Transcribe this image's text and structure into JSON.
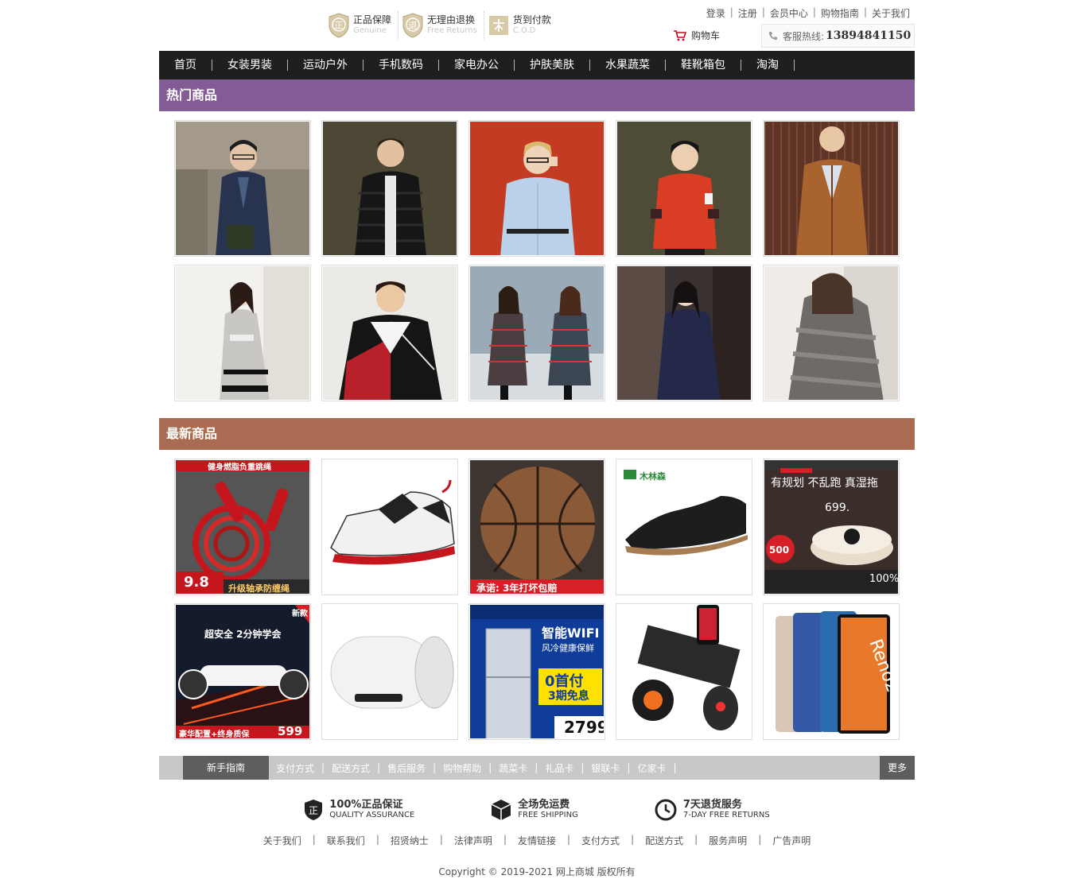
{
  "header": {
    "promises": [
      {
        "icon": "genuine-shield-icon",
        "glyph": "正",
        "cn": "正品保障",
        "en": "Genuine"
      },
      {
        "icon": "free-returns-shield-icon",
        "glyph": "退",
        "cn": "无理由退换",
        "en": "Free Returns"
      },
      {
        "icon": "cod-icon",
        "glyph": "",
        "cn": "货到付款",
        "en": "C.O.D"
      }
    ],
    "toplinks": [
      "登录",
      "注册",
      "会员中心",
      "购物指南",
      "关于我们"
    ],
    "cart_label": "购物车",
    "hotline_label": "客服热线:",
    "hotline_number": "13894841150"
  },
  "nav": [
    "首页",
    "女装男装",
    "运动户外",
    "手机数码",
    "家电办公",
    "护肤美肤",
    "水果蔬菜",
    "鞋靴箱包",
    "淘淘"
  ],
  "hot": {
    "title": "热门商品"
  },
  "latest": {
    "title": "最新商品",
    "labels": {
      "rope_top": "健身燃脂负重跳绳",
      "rope_price": "9.8",
      "rope_tag": "升级轴承防缠绳",
      "ball_tag": "承诺: 3年打坏包赔",
      "shoe_brand": "木林森",
      "robot_title": "有规划 不乱跑 真湿拖",
      "robot_price": "699.",
      "robot_badge": "500",
      "robot_pct": "100%",
      "scooter_top": "超安全 2分钟学会",
      "scooter_badge": "新款",
      "scooter_price": "599",
      "scooter_note": "豪华配置+终身质保",
      "fridge_tag": "智能WIFI",
      "fridge_sub": "风冷健康保鲜",
      "fridge_big": "0首付",
      "fridge_small": "3期免息",
      "fridge_price": "2799",
      "phone_text": "Reno2"
    }
  },
  "footer": {
    "help_first": "新手指南",
    "help_links": [
      "支付方式",
      "配送方式",
      "售后服务",
      "购物帮助",
      "蔬菜卡",
      "礼品卡",
      "银联卡",
      "亿家卡"
    ],
    "more": "更多",
    "guarantees": [
      {
        "icon": "genuine-badge-icon",
        "cn": "100%正品保证",
        "en": "QUALITY ASSURANCE"
      },
      {
        "icon": "shipping-box-icon",
        "cn": "全场免运费",
        "en": "FREE SHIPPING"
      },
      {
        "icon": "clock-icon",
        "cn": "7天退货服务",
        "en": "7-DAY FREE RETURNS"
      }
    ],
    "links": [
      "关于我们",
      "联系我们",
      "招贤纳士",
      "法律声明",
      "友情链接",
      "支付方式",
      "配送方式",
      "服务声明",
      "广告声明"
    ],
    "copyright": "Copyright © 2019-2021 网上商城 版权所有"
  },
  "colors": {
    "nav_bg": "#1f1f1f",
    "hot_bg": "#835b95",
    "new_bg": "#a96c52",
    "helpbar_bg": "#c8c8c8",
    "helpbar_dark": "#5e5e5e"
  }
}
